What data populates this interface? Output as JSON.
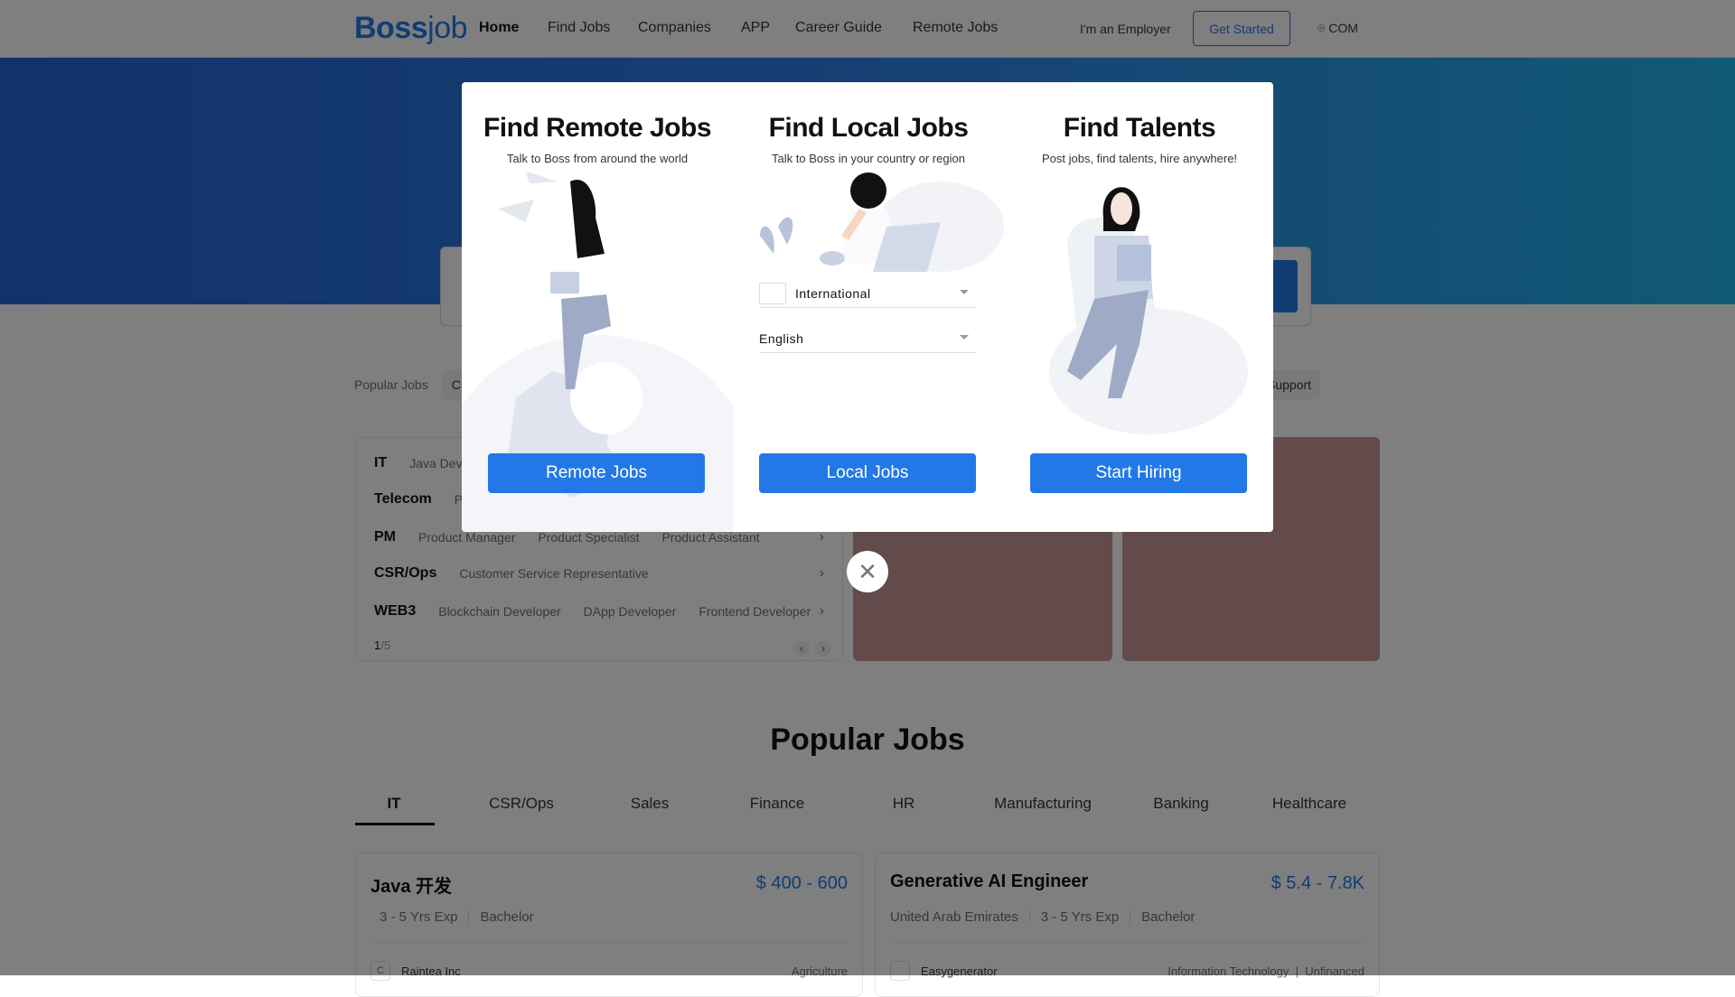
{
  "nav": {
    "logo": {
      "main": "Boss",
      "sub": "job"
    },
    "items": [
      "Home",
      "Find Jobs",
      "Companies",
      "APP",
      "Career Guide",
      "Remote Jobs"
    ],
    "employer": "I'm an Employer",
    "get_started": "Get Started",
    "location": "COM"
  },
  "popular_row": {
    "label": "Popular Jobs",
    "chips": [
      "Cu",
      "Support"
    ]
  },
  "categories": {
    "rows": [
      {
        "name": "IT",
        "jobs": [
          "Java Deve"
        ]
      },
      {
        "name": "Telecom",
        "jobs": [
          "Pr"
        ]
      },
      {
        "name": "PM",
        "jobs": [
          "Product Manager",
          "Product Specialist",
          "Product Assistant"
        ]
      },
      {
        "name": "CSR/Ops",
        "jobs": [
          "Customer Service Representative"
        ]
      },
      {
        "name": "WEB3",
        "jobs": [
          "Blockchain Developer",
          "DApp Developer",
          "Frontend Developer"
        ]
      }
    ],
    "page": "1",
    "total": "/5"
  },
  "popular_jobs": {
    "title": "Popular Jobs",
    "tabs": [
      "IT",
      "CSR/Ops",
      "Sales",
      "Finance",
      "HR",
      "Manufacturing",
      "Banking",
      "Healthcare"
    ],
    "active_tab": "IT",
    "cards": [
      {
        "title": "Java 开发",
        "salary": "$ 400 - 600",
        "meta": [
          "3 - 5 Yrs Exp",
          "Bachelor"
        ],
        "company": "Raintea Inc",
        "logo": "C",
        "industry": "Agriculture"
      },
      {
        "title": "Generative AI Engineer",
        "salary": "$ 5.4 - 7.8K",
        "meta": [
          "United Arab Emirates",
          "3 - 5 Yrs Exp",
          "Bachelor"
        ],
        "company": "Easygenerator",
        "logo": "",
        "industry": "Information Technology  |  Unfinanced"
      }
    ]
  },
  "modal": {
    "columns": [
      {
        "title": "Find Remote Jobs",
        "subtitle": "Talk to Boss from around the world",
        "button": "Remote Jobs"
      },
      {
        "title": "Find Local Jobs",
        "subtitle": "Talk to Boss in your country or region",
        "button": "Local Jobs",
        "country": "International",
        "language": "English"
      },
      {
        "title": "Find Talents",
        "subtitle": "Post jobs, find talents, hire anywhere!",
        "button": "Start Hiring"
      }
    ],
    "close_icon": "close-icon"
  },
  "colors": {
    "brand": "#2378e8",
    "banner": "#c69496"
  }
}
